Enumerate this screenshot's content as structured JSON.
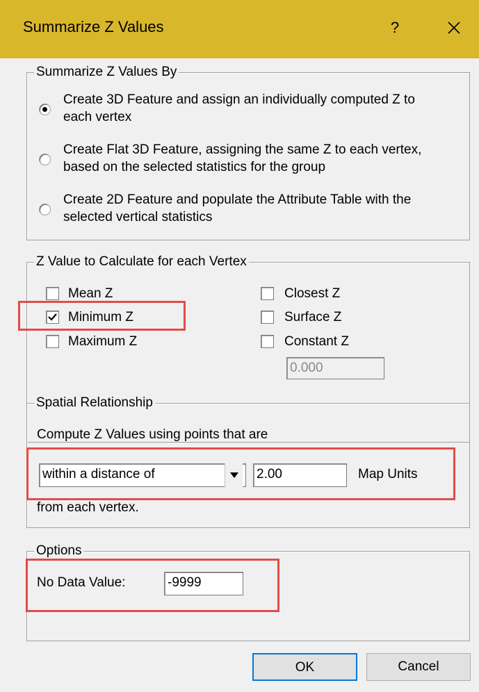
{
  "window": {
    "title": "Summarize Z Values",
    "help_label": "?"
  },
  "summarize_by": {
    "legend": "Summarize Z Values By",
    "options": [
      {
        "line1": "Create 3D Feature and assign an individually computed Z to",
        "line2": "each vertex",
        "selected": true
      },
      {
        "line1": "Create Flat 3D Feature, assigning the same Z to each vertex,",
        "line2": "based on the selected statistics for the group",
        "selected": false
      },
      {
        "line1": "Create 2D Feature and populate the Attribute Table with the",
        "line2": "selected vertical statistics",
        "selected": false
      }
    ]
  },
  "z_value": {
    "legend": "Z Value to Calculate for each Vertex",
    "mean_label": "Mean Z",
    "minimum_label": "Minimum Z",
    "maximum_label": "Maximum Z",
    "closest_label": "Closest Z",
    "surface_label": "Surface Z",
    "constant_label": "Constant Z",
    "constant_value": "0.000",
    "minimum_checked": true
  },
  "spatial": {
    "legend": "Spatial Relationship",
    "description": "Compute Z Values using points that are",
    "relationship_value": "within a distance of",
    "distance_value": "2.00",
    "units_label": "Map Units",
    "suffix": "from each vertex."
  },
  "options": {
    "legend": "Options",
    "no_data_label": "No Data Value:",
    "no_data_value": "-9999"
  },
  "buttons": {
    "ok": "OK",
    "cancel": "Cancel"
  },
  "colors": {
    "titlebar": "#d9b72b",
    "highlight": "#e34b48",
    "dialog_bg": "#f0f0f0"
  }
}
